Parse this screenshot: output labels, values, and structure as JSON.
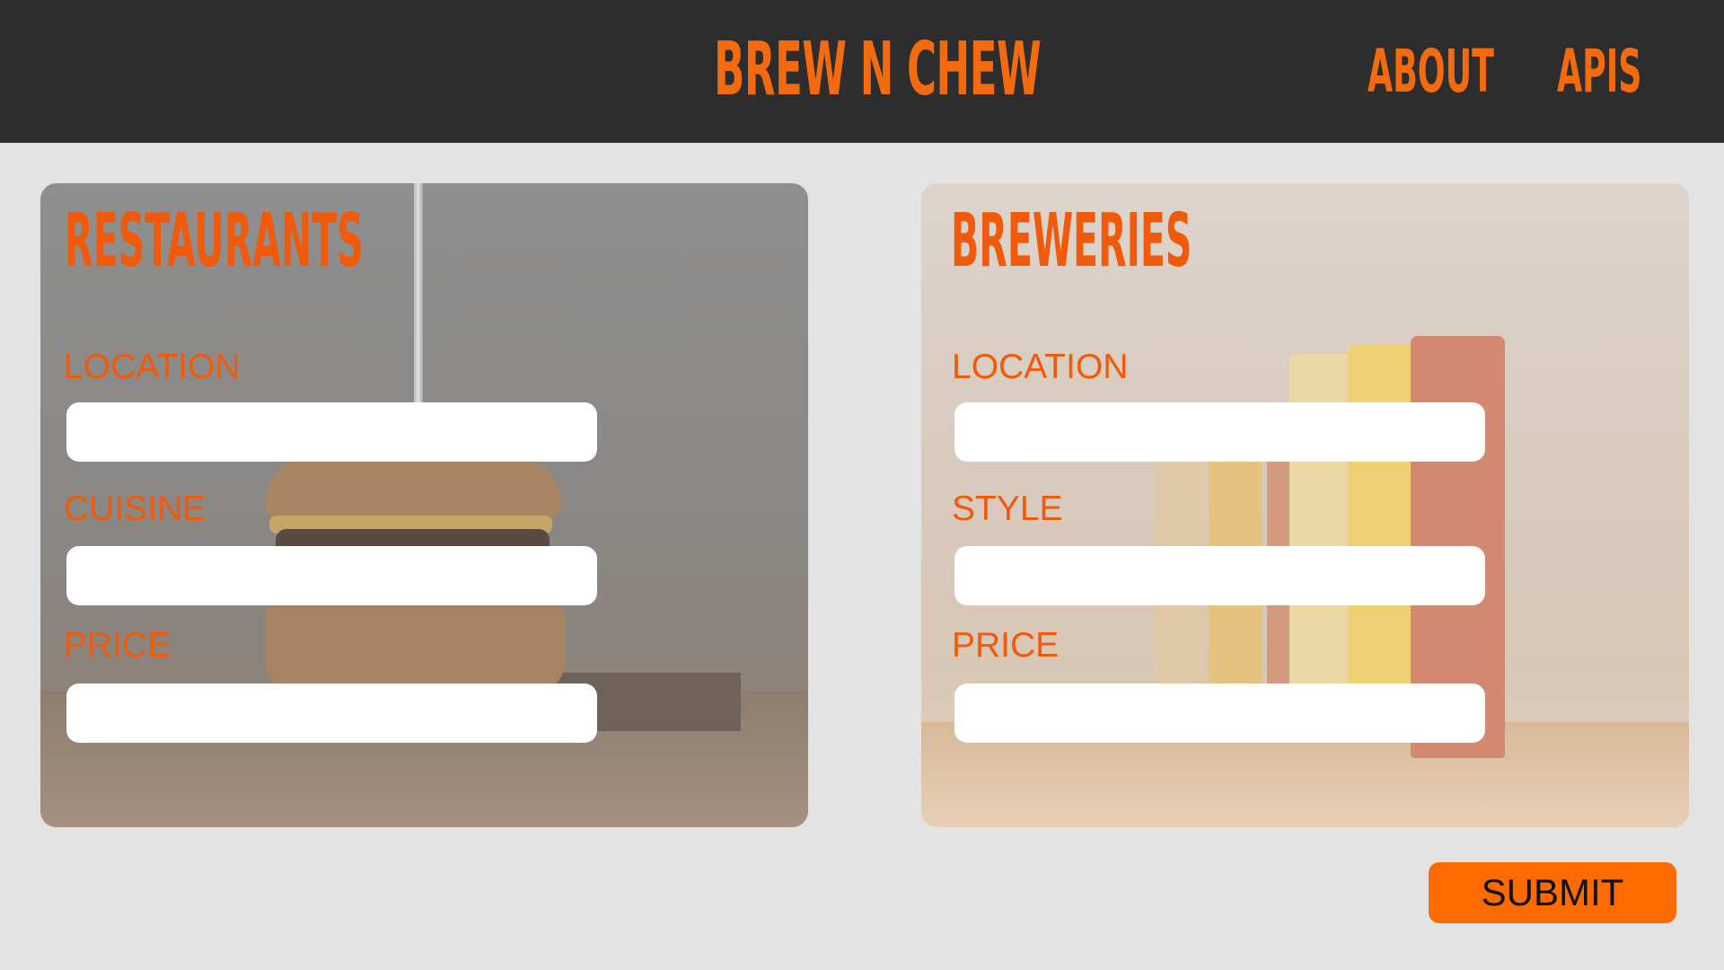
{
  "header": {
    "brand": "BREW N CHEW",
    "nav": [
      {
        "label": "ABOUT"
      },
      {
        "label": "APIS"
      }
    ]
  },
  "restaurants": {
    "title": "RESTAURANTS",
    "fields": [
      {
        "label": "LOCATION",
        "value": ""
      },
      {
        "label": "CUISINE",
        "value": ""
      },
      {
        "label": "PRICE",
        "value": ""
      }
    ]
  },
  "breweries": {
    "title": "BREWERIES",
    "fields": [
      {
        "label": "LOCATION",
        "value": ""
      },
      {
        "label": "STYLE",
        "value": ""
      },
      {
        "label": "PRICE",
        "value": ""
      }
    ]
  },
  "submit_label": "SUBMIT",
  "colors": {
    "accent": "#f36b0e",
    "header_bg": "#2d2d2d",
    "page_bg": "#e3e3e3",
    "submit_bg": "#fd6b00"
  }
}
